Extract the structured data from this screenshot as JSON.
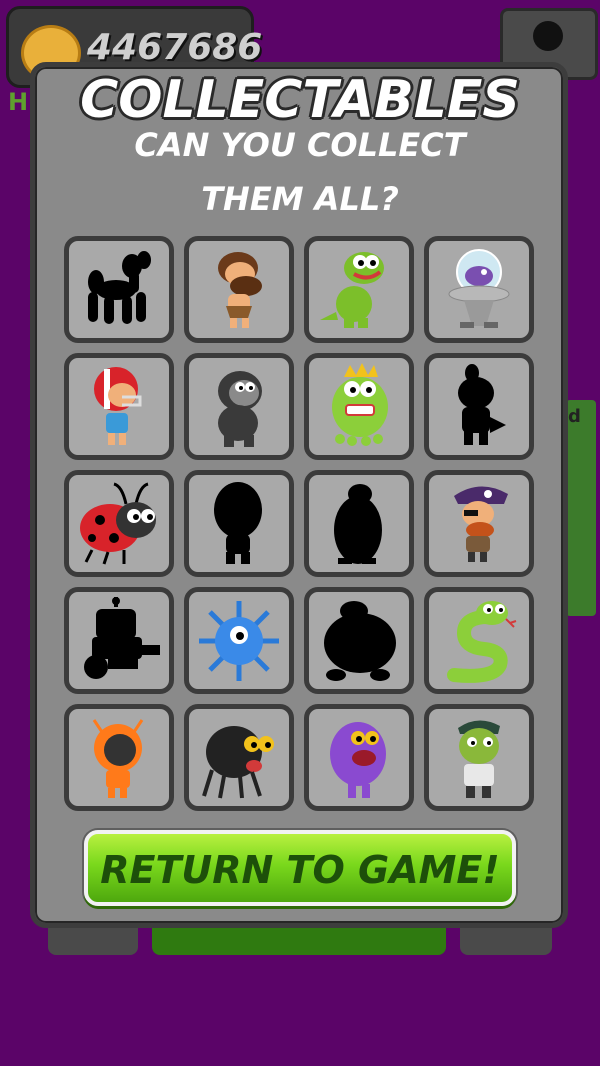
{
  "hud": {
    "coins": "4467686",
    "coin_icon": "coin-icon",
    "side_letter": "H",
    "side_card_letter": "d"
  },
  "modal": {
    "title": "COLLECTABLES",
    "subtitle_line1": "CAN YOU COLLECT",
    "subtitle_line2": "THEM ALL?",
    "return_button": "RETURN TO GAME!"
  },
  "collectables": [
    {
      "name": "balloon-dog",
      "collected": false
    },
    {
      "name": "caveman",
      "collected": true
    },
    {
      "name": "green-dinosaur",
      "collected": true
    },
    {
      "name": "alien-in-pod",
      "collected": true
    },
    {
      "name": "football-player",
      "collected": true
    },
    {
      "name": "gorilla",
      "collected": true
    },
    {
      "name": "frog-king",
      "collected": true
    },
    {
      "name": "ponytail-girl",
      "collected": false
    },
    {
      "name": "ladybug",
      "collected": true
    },
    {
      "name": "egg-creature",
      "collected": false
    },
    {
      "name": "penguin",
      "collected": false
    },
    {
      "name": "pirate",
      "collected": true
    },
    {
      "name": "robot",
      "collected": false
    },
    {
      "name": "blue-virus",
      "collected": true
    },
    {
      "name": "round-creature",
      "collected": false
    },
    {
      "name": "green-snake",
      "collected": true
    },
    {
      "name": "astronaut",
      "collected": true
    },
    {
      "name": "black-spider",
      "collected": true
    },
    {
      "name": "purple-monster",
      "collected": true
    },
    {
      "name": "zombie",
      "collected": true
    }
  ],
  "colors": {
    "background": "#5b0468",
    "panel": "#8a8a8a",
    "tile": "#a9a9a9",
    "button": "#7ad81c"
  }
}
